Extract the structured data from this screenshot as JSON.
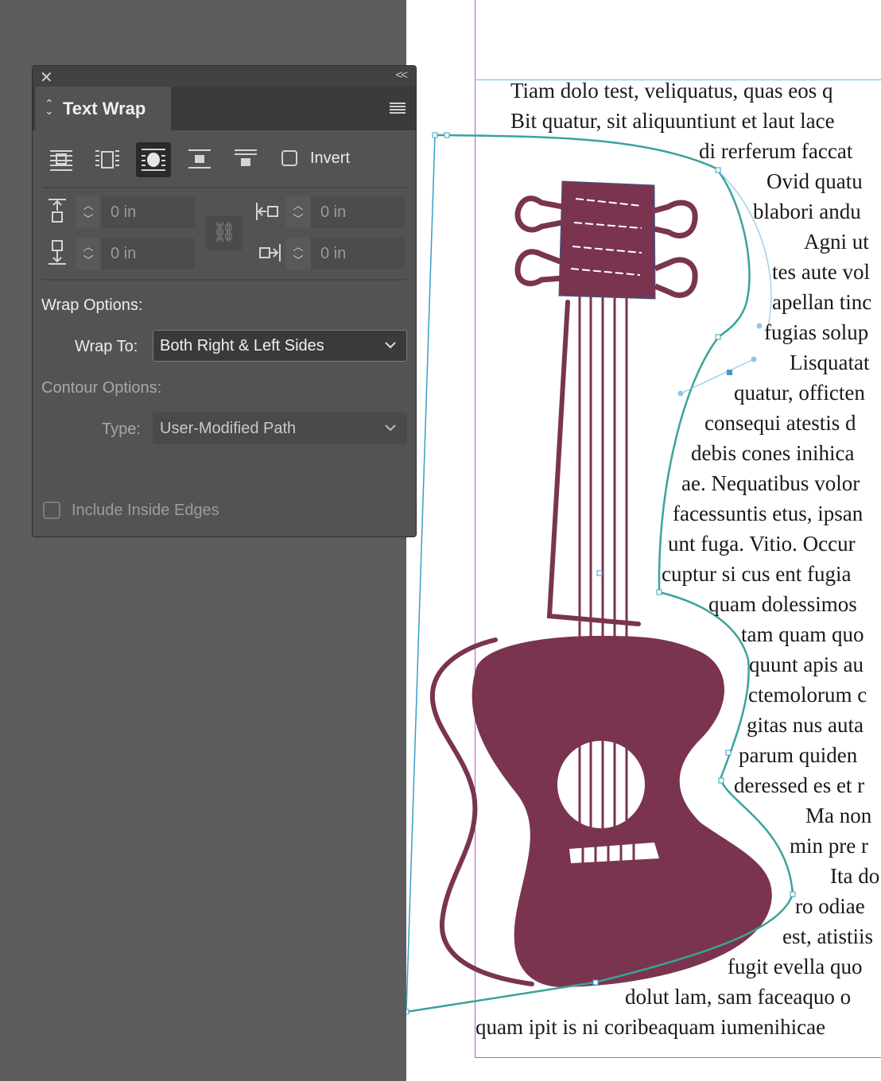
{
  "panel": {
    "title": "Text Wrap",
    "close_icon": "close-icon",
    "collapse_icon": "double-chevron-left-icon",
    "menu_icon": "panel-menu-icon",
    "wrap_modes": [
      {
        "name": "no-text-wrap",
        "selected": false
      },
      {
        "name": "wrap-around-bounding-box",
        "selected": false
      },
      {
        "name": "wrap-around-object-shape",
        "selected": true
      },
      {
        "name": "jump-object",
        "selected": false
      },
      {
        "name": "jump-to-next-column",
        "selected": false
      }
    ],
    "invert_label": "Invert",
    "invert_checked": false,
    "offsets": {
      "top": "0 in",
      "bottom": "0 in",
      "left": "0 in",
      "right": "0 in"
    },
    "wrap_options_label": "Wrap Options:",
    "wrap_to_label": "Wrap To:",
    "wrap_to_value": "Both Right & Left Sides",
    "contour_options_label": "Contour Options:",
    "type_label": "Type:",
    "type_value": "User-Modified Path",
    "include_inside_edges_label": "Include Inside Edges",
    "include_inside_edges_checked": false
  },
  "document": {
    "lines": [
      "Tiam dolo test, veliquatus, quas eos q",
      "Bit quatur, sit aliquuntiunt et laut lace",
      "di rerferum faccat",
      "Ovid quatu",
      "blabori andu",
      "Agni ut",
      "tes aute vol",
      "apellan tinc",
      "fugias solup",
      "Lisquatat",
      "quatur, officten",
      "consequi atestis d",
      "debis cones inihica",
      "ae. Nequatibus volor",
      "facessuntis etus, ipsan",
      "unt fuga. Vitio. Occur",
      "cuptur si cus ent fugia",
      "quam dolessimos",
      "tam quam quo",
      "quunt apis au",
      "ctemolorum c",
      "gitas nus auta",
      "parum quiden",
      "deressed es et r",
      "Ma non",
      "min pre r",
      "Ita do",
      "ro odiae",
      "est, atistiis",
      "fugit evella quo",
      "dolut lam, sam faceaquo o",
      "quam ipit is ni coribeaquam iumenihicae"
    ],
    "guitar_color": "#7a3450",
    "wrap_path_color": "#3aa39a",
    "margin_guide_color": "#b35ad3"
  }
}
